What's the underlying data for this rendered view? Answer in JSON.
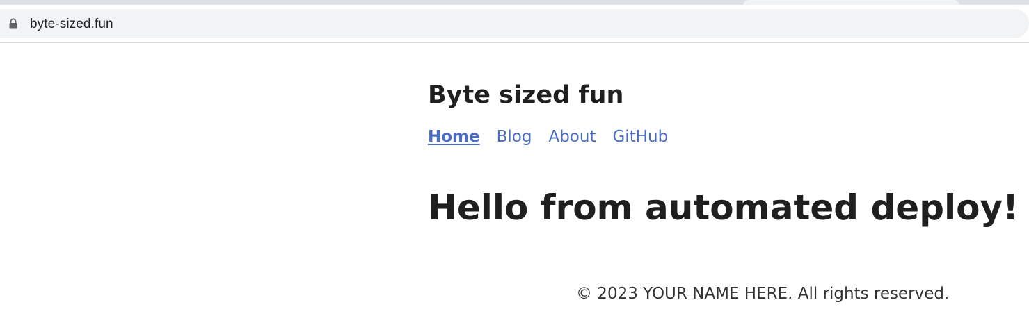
{
  "browser": {
    "url": "byte-sized.fun"
  },
  "site": {
    "title": "Byte sized fun",
    "nav": [
      {
        "label": "Home",
        "active": true
      },
      {
        "label": "Blog",
        "active": false
      },
      {
        "label": "About",
        "active": false
      },
      {
        "label": "GitHub",
        "active": false
      }
    ],
    "hero": "Hello from automated deploy!",
    "footer": "© 2023 YOUR NAME HERE. All rights reserved."
  },
  "icons": {
    "lock": "lock-icon"
  },
  "colors": {
    "link": "#4a6dc2",
    "text": "#1f1f1f",
    "chrome": "#dee1e6",
    "omnibox": "#f1f3f4"
  }
}
